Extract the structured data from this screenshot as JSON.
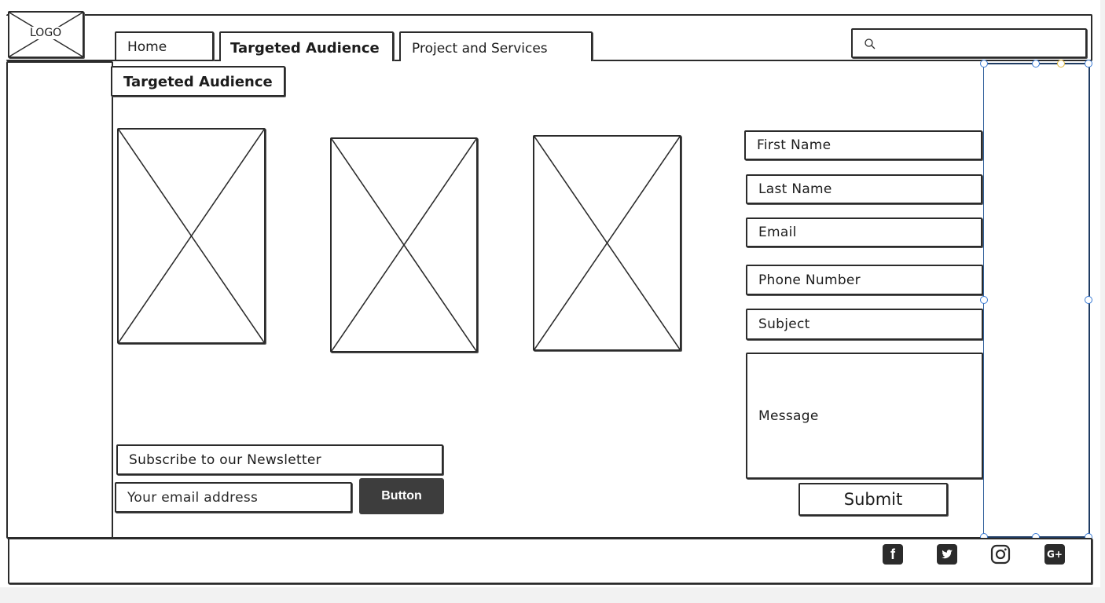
{
  "header": {
    "logo": "LOGO",
    "nav": [
      "Home",
      "Targeted Audience",
      "Project and Services"
    ],
    "search_icon": "search-icon"
  },
  "main": {
    "section_title": "Targeted Audience"
  },
  "contact_form": {
    "first_name": "First Name",
    "last_name": "Last Name",
    "email": "Email",
    "phone": "Phone Number",
    "subject": "Subject",
    "message": "Message",
    "submit": "Submit"
  },
  "newsletter": {
    "label": "Subscribe to our Newsletter",
    "email_placeholder": "Your email address",
    "button": "Button"
  },
  "footer": {
    "social_icons": [
      {
        "name": "facebook-icon",
        "glyph": "f"
      },
      {
        "name": "twitter-icon",
        "glyph": "t"
      },
      {
        "name": "instagram-icon",
        "glyph": "◎"
      },
      {
        "name": "google-plus-icon",
        "glyph": "G+"
      }
    ]
  },
  "colors": {
    "stroke": "#2b2b2b",
    "selection": "#3b7bd4",
    "button_dark": "#3d3d3d"
  }
}
